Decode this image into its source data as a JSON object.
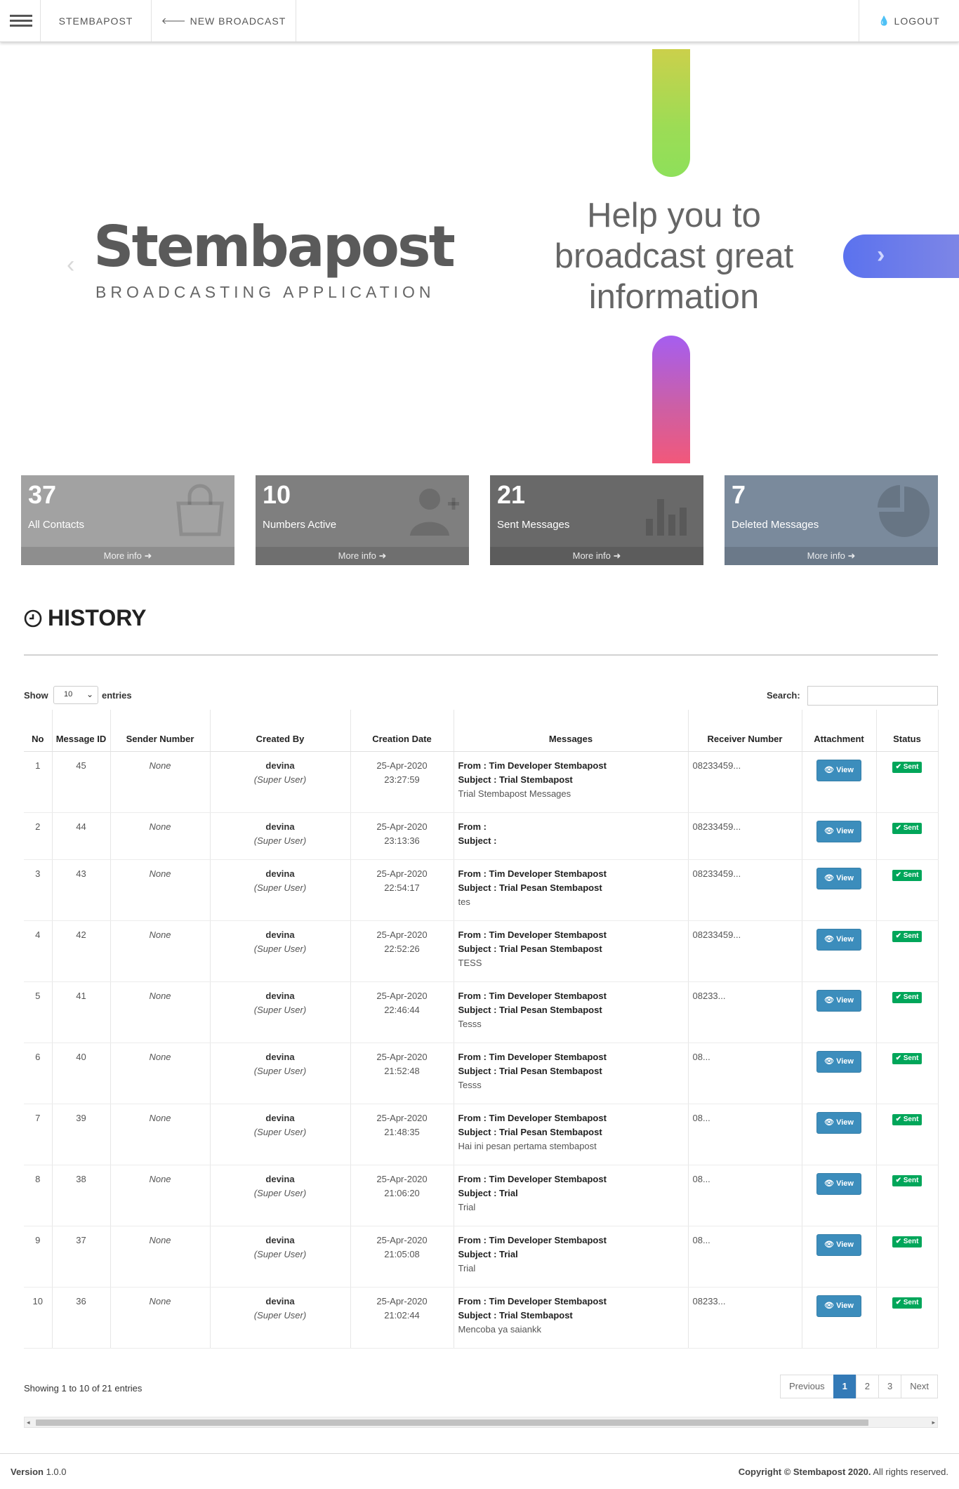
{
  "nav": {
    "brand": "STEMBAPOST",
    "new_broadcast": "NEW BROADCAST",
    "logout": "LOGOUT"
  },
  "hero": {
    "logo_text": "Stembapost",
    "tagline": "BROADCASTING APPLICATION",
    "headline_lines": [
      "Help you to",
      "broadcast great",
      "information"
    ],
    "prev_glyph": "‹",
    "next_glyph": "›",
    "pill_top_colors": [
      "#cbd04b",
      "#8ee05a"
    ],
    "pill_bottom_colors": [
      "#a55ef0",
      "#f2587a"
    ],
    "next_button_color": "#5b72ee"
  },
  "stats": [
    {
      "value": "37",
      "label": "All Contacts",
      "more": "More info",
      "icon": "shopping-bag-icon",
      "color": "#a2a2a2"
    },
    {
      "value": "10",
      "label": "Numbers Active",
      "more": "More info",
      "icon": "user-plus-icon",
      "color": "#7f7f7f"
    },
    {
      "value": "21",
      "label": "Sent Messages",
      "more": "More info",
      "icon": "bar-chart-icon",
      "color": "#696969"
    },
    {
      "value": "7",
      "label": "Deleted Messages",
      "more": "More info",
      "icon": "pie-chart-icon",
      "color": "#7a8a9c"
    }
  ],
  "history": {
    "title": "HISTORY",
    "show_label": "Show",
    "entries_label": "entries",
    "page_size": "10",
    "search_label": "Search:",
    "search_value": "",
    "columns": [
      "No",
      "Message ID",
      "Sender Number",
      "Created By",
      "Creation Date",
      "Messages",
      "Receiver Number",
      "Attachment",
      "Status"
    ],
    "rows": [
      {
        "no": "1",
        "id": "45",
        "sender": "None",
        "user": "devina",
        "role": "(Super User)",
        "date": "25-Apr-2020",
        "time": "23:27:59",
        "from": "From : Tim Developer Stembapost",
        "subject": "Subject : Trial Stembapost",
        "body": "Trial Stembapost Messages",
        "receiver": "08233459...",
        "view": "View",
        "status": "Sent"
      },
      {
        "no": "2",
        "id": "44",
        "sender": "None",
        "user": "devina",
        "role": "(Super User)",
        "date": "25-Apr-2020",
        "time": "23:13:36",
        "from": "From :",
        "subject": "Subject :",
        "body": "",
        "receiver": "08233459...",
        "view": "View",
        "status": "Sent"
      },
      {
        "no": "3",
        "id": "43",
        "sender": "None",
        "user": "devina",
        "role": "(Super User)",
        "date": "25-Apr-2020",
        "time": "22:54:17",
        "from": "From : Tim Developer Stembapost",
        "subject": "Subject : Trial Pesan Stembapost",
        "body": "tes",
        "receiver": "08233459...",
        "view": "View",
        "status": "Sent"
      },
      {
        "no": "4",
        "id": "42",
        "sender": "None",
        "user": "devina",
        "role": "(Super User)",
        "date": "25-Apr-2020",
        "time": "22:52:26",
        "from": "From : Tim Developer Stembapost",
        "subject": "Subject : Trial Pesan Stembapost",
        "body": "TESS",
        "receiver": "08233459...",
        "view": "View",
        "status": "Sent"
      },
      {
        "no": "5",
        "id": "41",
        "sender": "None",
        "user": "devina",
        "role": "(Super User)",
        "date": "25-Apr-2020",
        "time": "22:46:44",
        "from": "From : Tim Developer Stembapost",
        "subject": "Subject : Trial Pesan Stembapost",
        "body": "Tesss",
        "receiver": "08233...",
        "view": "View",
        "status": "Sent"
      },
      {
        "no": "6",
        "id": "40",
        "sender": "None",
        "user": "devina",
        "role": "(Super User)",
        "date": "25-Apr-2020",
        "time": "21:52:48",
        "from": "From : Tim Developer Stembapost",
        "subject": "Subject : Trial Pesan Stembapost",
        "body": "Tesss",
        "receiver": "08...",
        "view": "View",
        "status": "Sent"
      },
      {
        "no": "7",
        "id": "39",
        "sender": "None",
        "user": "devina",
        "role": "(Super User)",
        "date": "25-Apr-2020",
        "time": "21:48:35",
        "from": "From : Tim Developer Stembapost",
        "subject": "Subject : Trial Pesan Stembapost",
        "body": "Hai ini pesan pertama stembapost",
        "receiver": "08...",
        "view": "View",
        "status": "Sent"
      },
      {
        "no": "8",
        "id": "38",
        "sender": "None",
        "user": "devina",
        "role": "(Super User)",
        "date": "25-Apr-2020",
        "time": "21:06:20",
        "from": "From : Tim Developer Stembapost",
        "subject": "Subject : Trial",
        "body": "Trial",
        "receiver": "08...",
        "view": "View",
        "status": "Sent"
      },
      {
        "no": "9",
        "id": "37",
        "sender": "None",
        "user": "devina",
        "role": "(Super User)",
        "date": "25-Apr-2020",
        "time": "21:05:08",
        "from": "From : Tim Developer Stembapost",
        "subject": "Subject : Trial",
        "body": "Trial",
        "receiver": "08...",
        "view": "View",
        "status": "Sent"
      },
      {
        "no": "10",
        "id": "36",
        "sender": "None",
        "user": "devina",
        "role": "(Super User)",
        "date": "25-Apr-2020",
        "time": "21:02:44",
        "from": "From : Tim Developer Stembapost",
        "subject": "Subject : Trial Stembapost",
        "body": "Mencoba ya saiankk",
        "receiver": "08233...",
        "view": "View",
        "status": "Sent"
      }
    ],
    "showing": "Showing 1 to 10 of 21 entries",
    "pagination": {
      "previous": "Previous",
      "pages": [
        "1",
        "2",
        "3"
      ],
      "active": "1",
      "next": "Next"
    }
  },
  "footer": {
    "version_label": "Version",
    "version": "1.0.0",
    "copyright_bold": "Copyright © Stembapost 2020.",
    "copyright_rest": "All rights reserved."
  }
}
